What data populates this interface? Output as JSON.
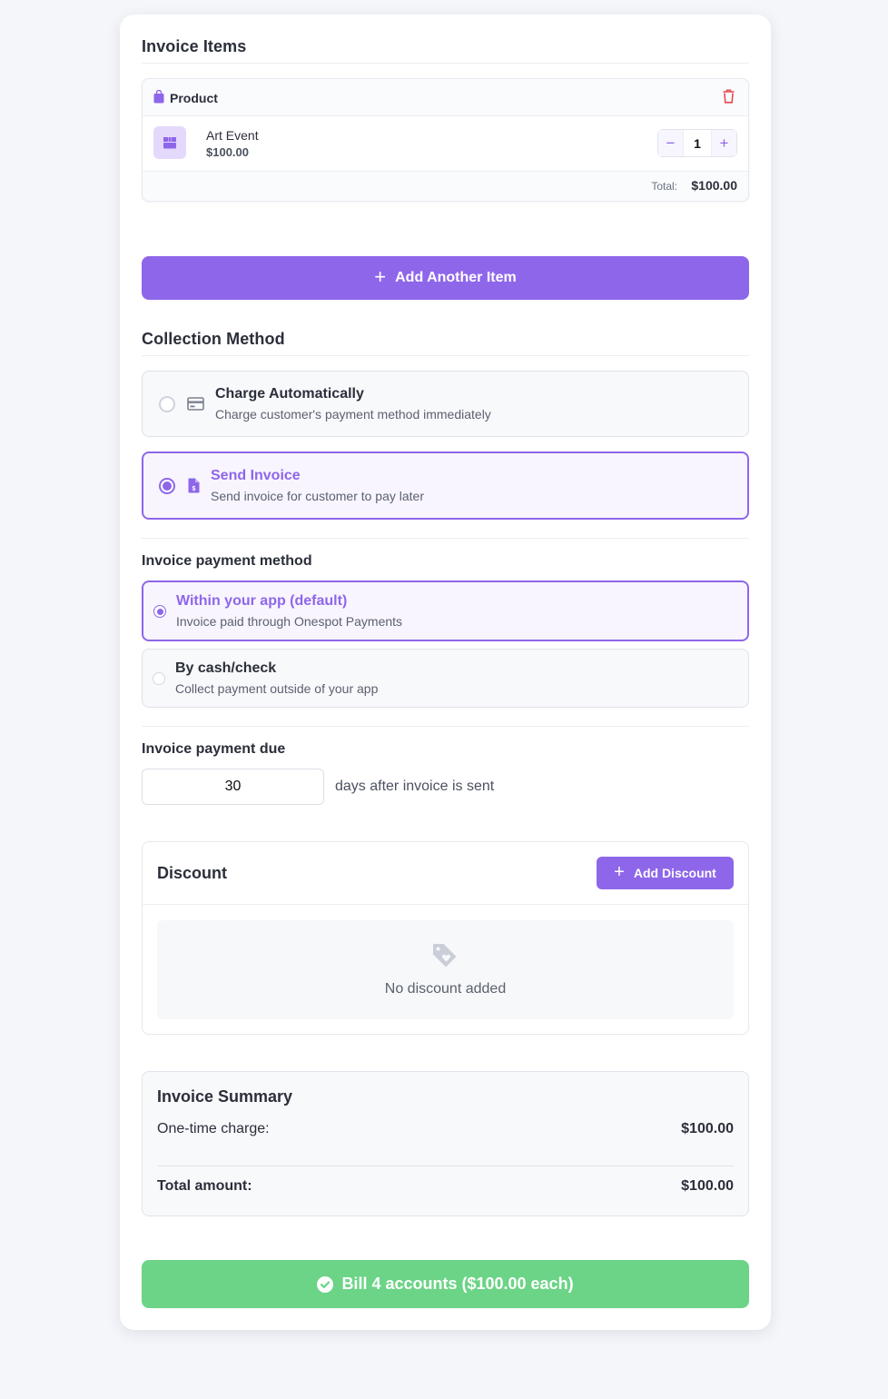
{
  "invoice_items": {
    "title": "Invoice Items",
    "item": {
      "type_label": "Product",
      "name": "Art Event",
      "price": "$100.00",
      "quantity": "1",
      "total_label": "Total:",
      "total_value": "$100.00"
    },
    "add_button_label": "Add Another Item"
  },
  "collection_method": {
    "title": "Collection Method",
    "options": [
      {
        "title": "Charge Automatically",
        "subtitle": "Charge customer's payment method immediately",
        "selected": false,
        "icon": "credit-card-icon"
      },
      {
        "title": "Send Invoice",
        "subtitle": "Send invoice for customer to pay later",
        "selected": true,
        "icon": "invoice-dollar-icon"
      }
    ]
  },
  "payment_method": {
    "title": "Invoice payment method",
    "options": [
      {
        "title": "Within your app (default)",
        "subtitle": "Invoice paid through Onespot Payments",
        "selected": true
      },
      {
        "title": "By cash/check",
        "subtitle": "Collect payment outside of your app",
        "selected": false
      }
    ]
  },
  "payment_due": {
    "title": "Invoice payment due",
    "days": "30",
    "suffix": "days after invoice is sent"
  },
  "discount": {
    "title": "Discount",
    "add_button_label": "Add Discount",
    "empty_text": "No discount added"
  },
  "summary": {
    "title": "Invoice Summary",
    "one_time_label": "One-time charge:",
    "one_time_value": "$100.00",
    "total_label": "Total amount:",
    "total_value": "$100.00"
  },
  "bill_button_label": "Bill 4 accounts ($100.00 each)",
  "colors": {
    "accent": "#8e66ea",
    "success": "#6bd486",
    "danger": "#e5484d",
    "background": "#f5f6fa"
  }
}
